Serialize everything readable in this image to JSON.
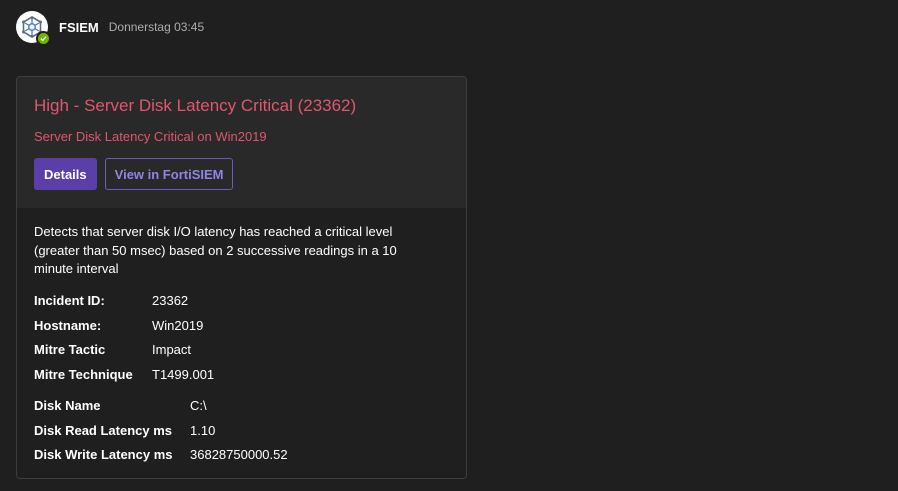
{
  "message": {
    "sender": "FSIEM",
    "timestamp": "Donnerstag 03:45",
    "avatar_icon": "fortisiem-logo-icon",
    "presence_icon": "available-check-icon"
  },
  "card": {
    "title": "High - Server Disk Latency Critical (23362)",
    "subtitle": "Server Disk Latency Critical on Win2019",
    "accent_color": "#e0566e",
    "actions": {
      "details_label": "Details",
      "view_label": "View in FortiSIEM"
    },
    "description": "Detects that server disk I/O latency has reached a critical level (greater than 50 msec) based on 2 successive readings in a 10 minute interval",
    "facts": [
      {
        "key": "Incident ID:",
        "value": "23362"
      },
      {
        "key": "Hostname:",
        "value": "Win2019"
      },
      {
        "key": "Mitre Tactic",
        "value": "Impact"
      },
      {
        "key": "Mitre Technique",
        "value": "T1499.001"
      }
    ],
    "details": [
      {
        "key": "Disk Name",
        "value": "C:\\"
      },
      {
        "key": "Disk Read Latency ms",
        "value": "1.10"
      },
      {
        "key": "Disk Write Latency ms",
        "value": "36828750000.52"
      }
    ]
  }
}
